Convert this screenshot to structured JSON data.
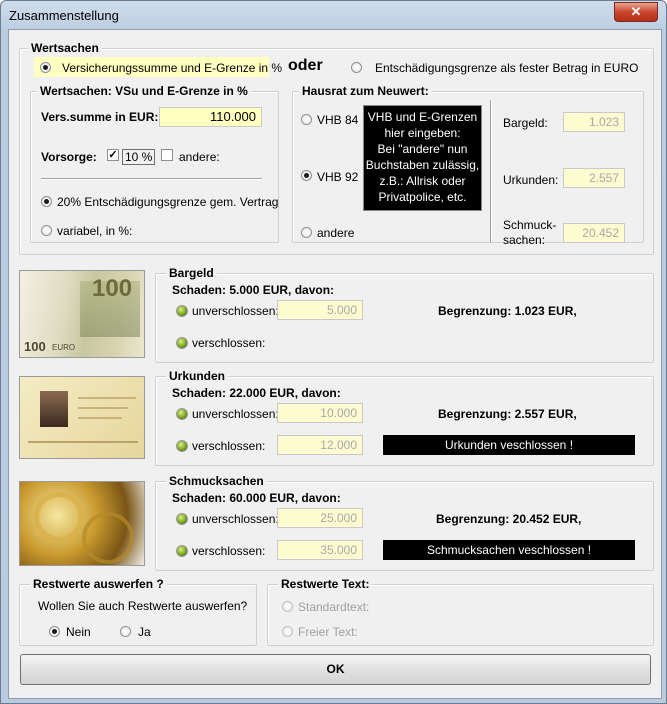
{
  "window": {
    "title": "Zusammenstellung",
    "close_glyph": "✕"
  },
  "wertsachen": {
    "legend": "Wertsachen",
    "radio_vsu": "Versicherungssumme und E-Grenze in %",
    "oder": "oder",
    "radio_fix": "Entschädigungsgrenze als fester Betrag in EURO"
  },
  "vsu_group": {
    "legend": "Wertsachen: VSu und E-Grenze in %",
    "vers_label": "Vers.summe in EUR:",
    "vers_value": "110.000",
    "vorsorge_label": "Vorsorge:",
    "vorsorge_check": "✓",
    "vorsorge_pct": "10 %",
    "andere_label": "andere:",
    "radio_20": "20% Entschädigungsgrenze gem. Vertrag",
    "radio_variabel": "variabel, in %:"
  },
  "hausrat": {
    "legend": "Hausrat zum Neuwert:",
    "vhb84": "VHB 84",
    "vhb92": "VHB 92",
    "andere": "andere",
    "info_lines": [
      "VHB und E-Grenzen",
      "hier eingeben:",
      "Bei \"andere\" nun",
      "Buchstaben zulässig,",
      "z.B.:  Allrisk oder",
      "Privatpolice, etc."
    ],
    "bargeld_label": "Bargeld:",
    "bargeld_value": "1.023",
    "urkunden_label": "Urkunden:",
    "urkunden_value": "2.557",
    "schmuck_label_1": "Schmuck-",
    "schmuck_label_2": "sachen:",
    "schmuck_value": "20.452"
  },
  "sections": [
    {
      "legend": "Bargeld",
      "schaden": "Schaden:   5.000 EUR, davon:",
      "unv_label": "unverschlossen:",
      "unv_value": "5.000",
      "ver_label": "verschlossen:",
      "ver_value": "",
      "begrenzung": "Begrenzung: 1.023 EUR,",
      "warning": ""
    },
    {
      "legend": "Urkunden",
      "schaden": "Schaden:   22.000 EUR, davon:",
      "unv_label": "unverschlossen:",
      "unv_value": "10.000",
      "ver_label": "verschlossen:",
      "ver_value": "12.000",
      "begrenzung": "Begrenzung: 2.557 EUR,",
      "warning": "Urkunden  veschlossen !"
    },
    {
      "legend": "Schmucksachen",
      "schaden": "Schaden:   60.000 EUR, davon:",
      "unv_label": "unverschlossen:",
      "unv_value": "25.000",
      "ver_label": "verschlossen:",
      "ver_value": "35.000",
      "begrenzung": "Begrenzung: 20.452 EUR,",
      "warning": "Schmucksachen  veschlossen !"
    }
  ],
  "banknote": {
    "value": "100",
    "currency": "EURO"
  },
  "restwerte": {
    "legend": "Restwerte auswerfen ?",
    "question": "Wollen Sie auch Restwerte auswerfen?",
    "nein": "Nein",
    "ja": "Ja"
  },
  "restwerte_text": {
    "legend": "Restwerte Text:",
    "standard": "Standardtext:",
    "freier": "Freier Text:"
  },
  "ok_label": "OK"
}
